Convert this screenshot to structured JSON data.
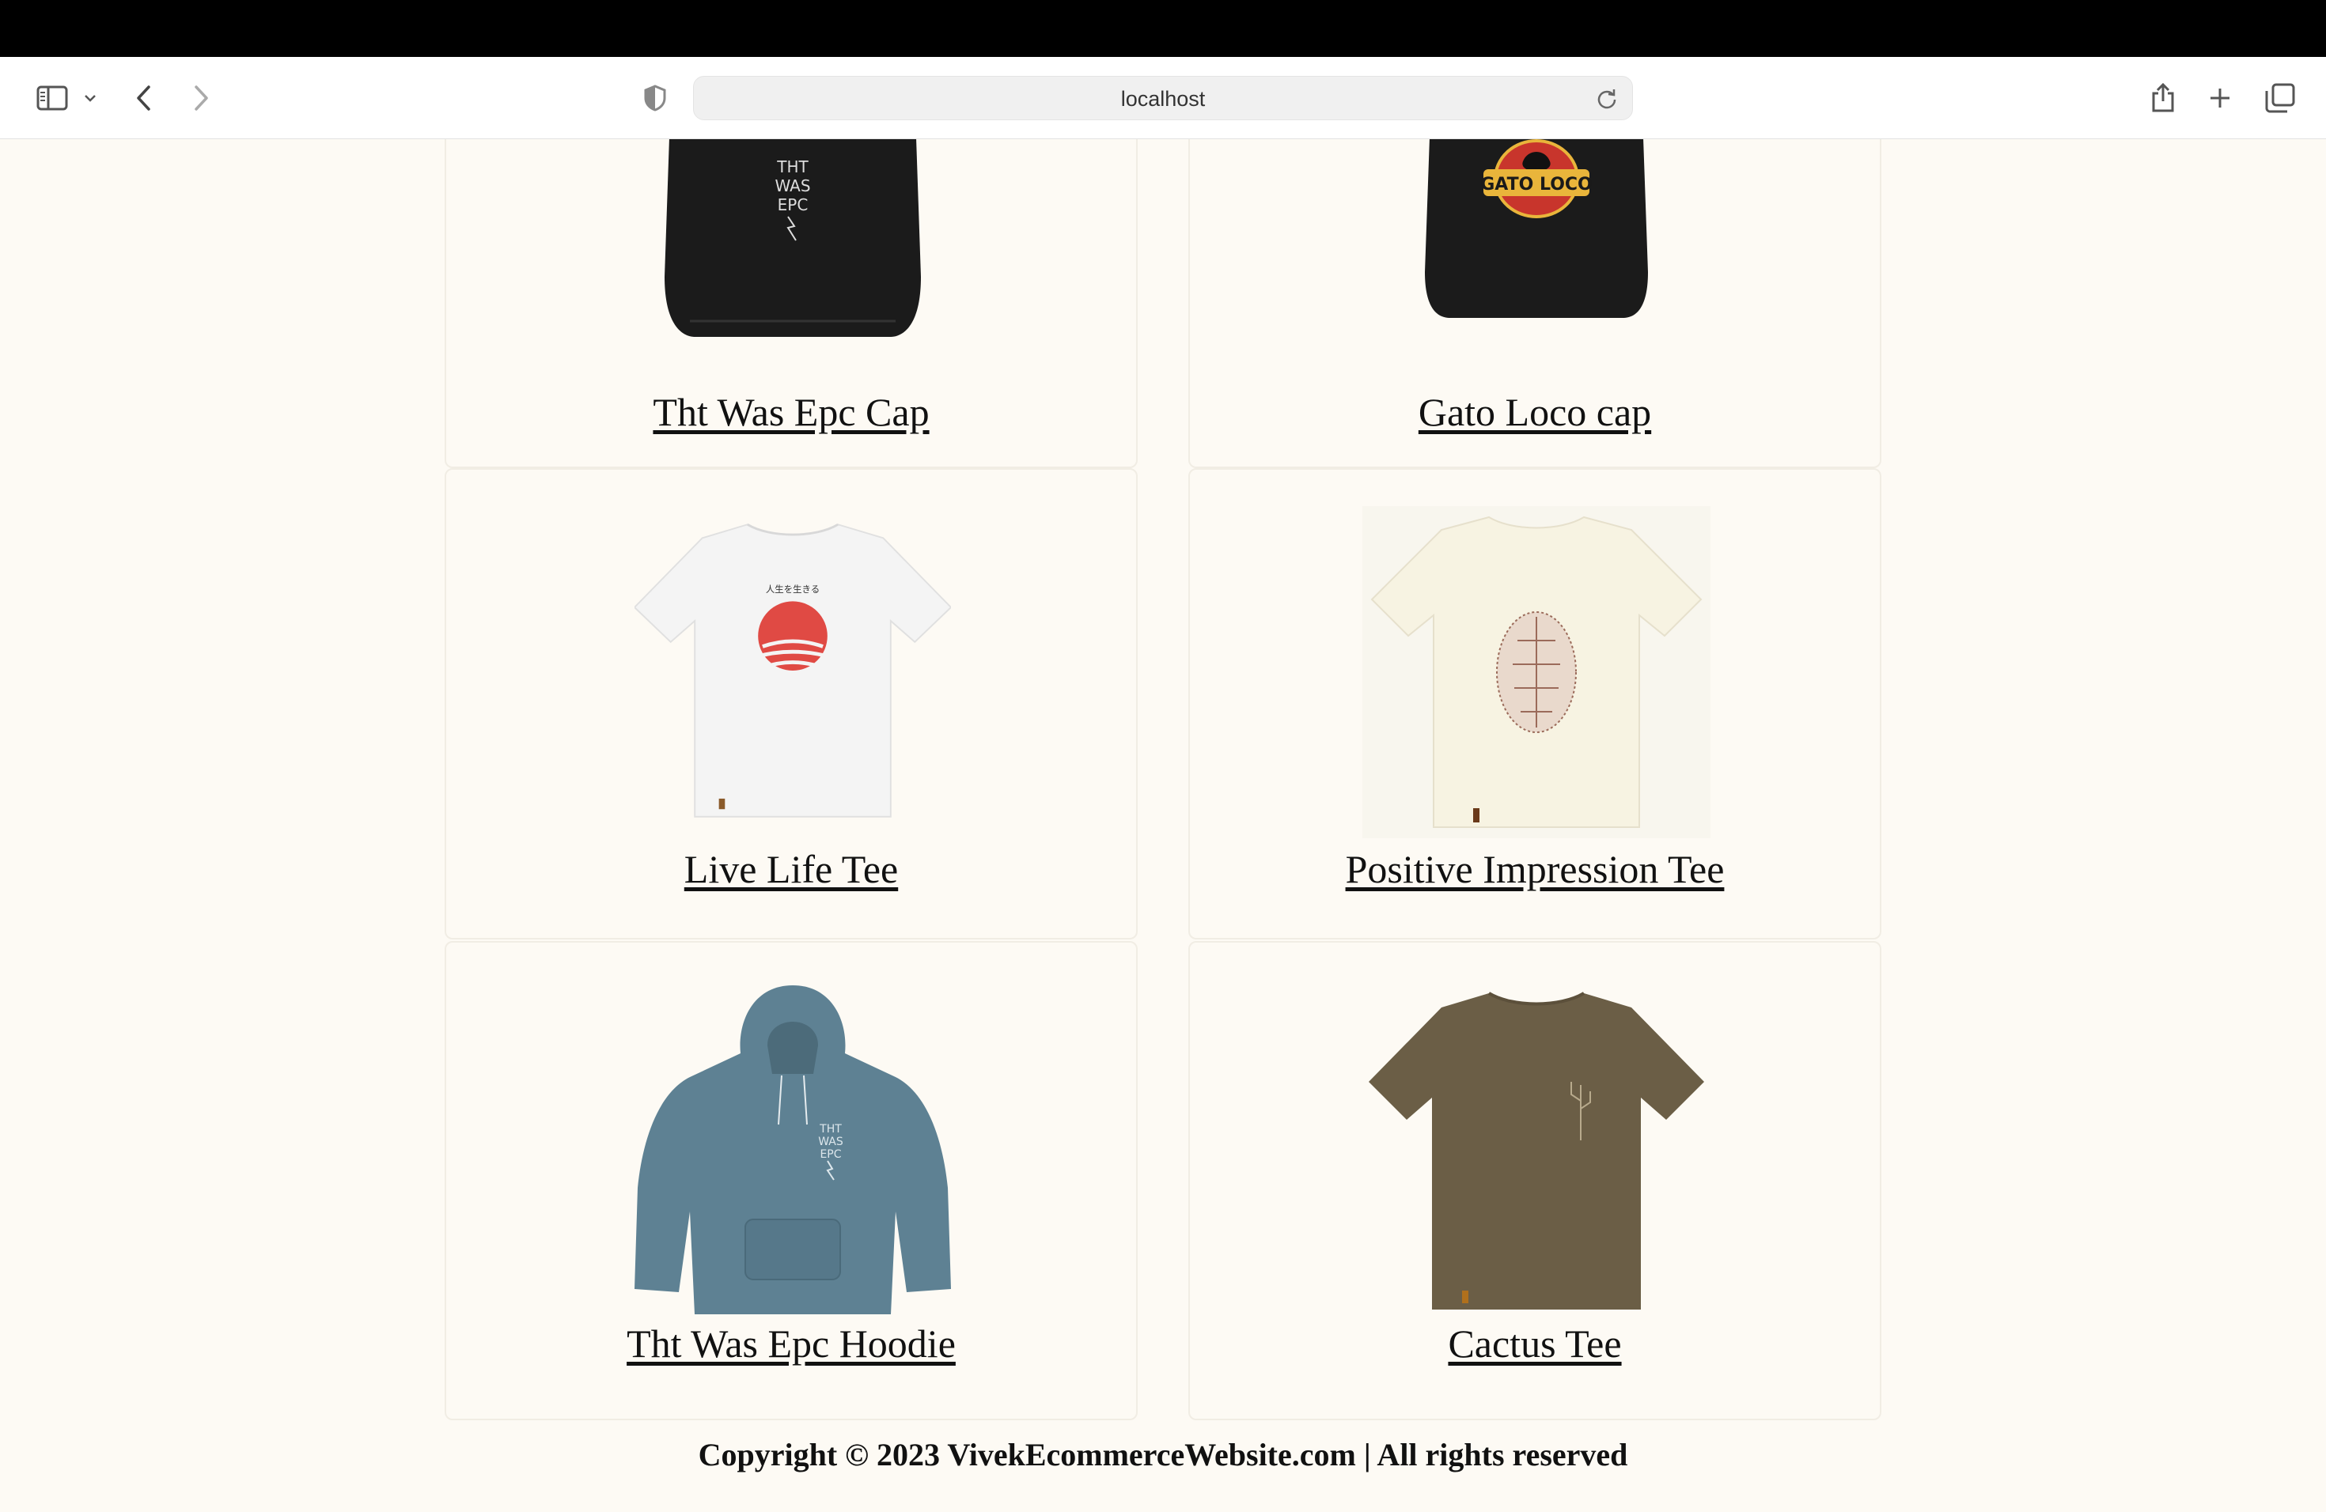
{
  "browser": {
    "url": "localhost"
  },
  "products": [
    {
      "name": "Tht Was Epc Cap",
      "graphic_text": [
        "THT",
        "WAS",
        "EPC"
      ]
    },
    {
      "name": "Gato Loco cap",
      "graphic_text": "GATO LOCO"
    },
    {
      "name": "Live Life Tee",
      "graphic_text": "人生を生きる"
    },
    {
      "name": "Positive Impression Tee"
    },
    {
      "name": "Tht Was Epc Hoodie",
      "graphic_text": [
        "THT",
        "WAS",
        "EPC"
      ]
    },
    {
      "name": "Cactus Tee"
    }
  ],
  "footer": {
    "text": "Copyright © 2023 VivekEcommerceWebsite.com | All rights reserved"
  }
}
